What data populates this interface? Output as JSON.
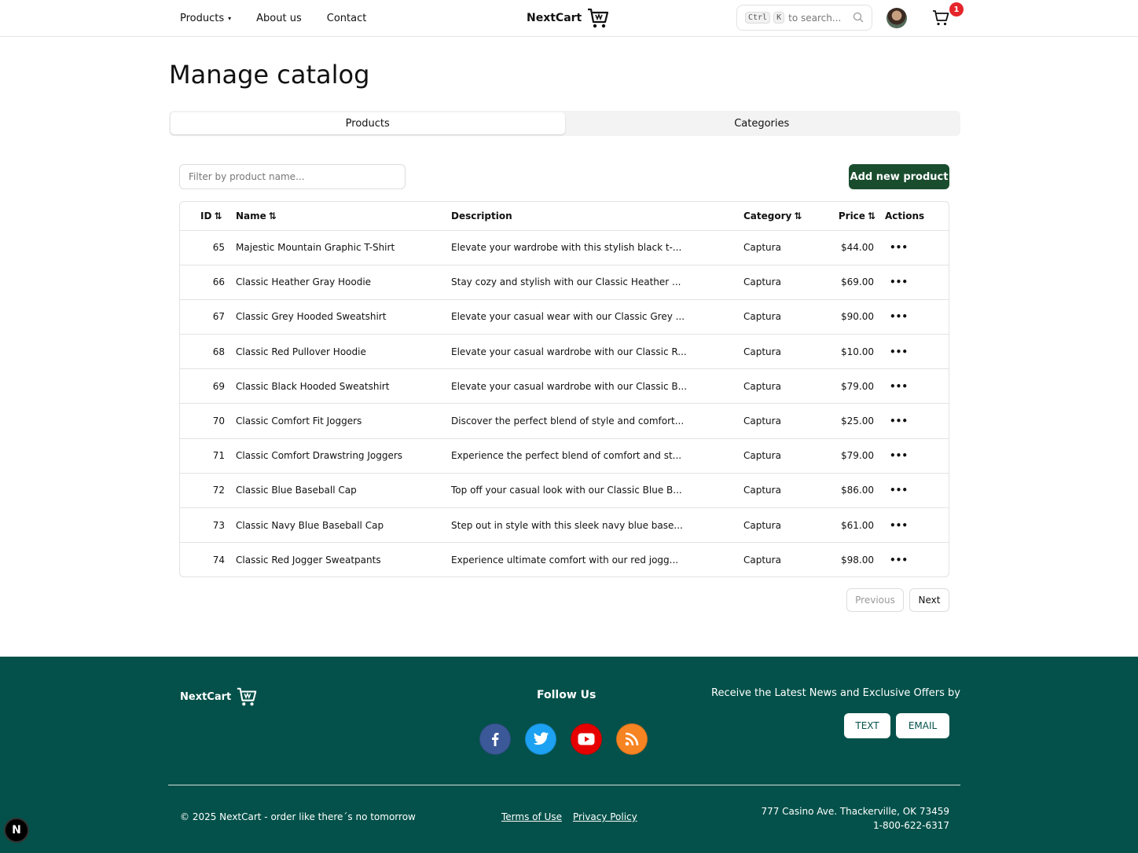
{
  "header": {
    "nav": [
      {
        "label": "Products",
        "has_dropdown": true
      },
      {
        "label": "About us"
      },
      {
        "label": "Contact"
      }
    ],
    "brand": "NextCart",
    "search": {
      "kbd1": "Ctrl",
      "kbd2": "K",
      "placeholder": "to search..."
    },
    "cart_count": "1"
  },
  "main": {
    "title": "Manage catalog",
    "tabs": [
      {
        "label": "Products",
        "active": true
      },
      {
        "label": "Categories",
        "active": false
      }
    ],
    "filter_placeholder": "Filter by product name...",
    "add_button": "Add new product",
    "columns": {
      "id": "ID",
      "name": "Name",
      "description": "Description",
      "category": "Category",
      "price": "Price",
      "actions": "Actions"
    },
    "sort_glyph": "⇅",
    "actions_glyph": "•••",
    "rows": [
      {
        "id": "65",
        "name": "Majestic Mountain Graphic T-Shirt",
        "description": "Elevate your wardrobe with this stylish black t-...",
        "category": "Captura",
        "price": "$44.00"
      },
      {
        "id": "66",
        "name": "Classic Heather Gray Hoodie",
        "description": "Stay cozy and stylish with our Classic Heather ...",
        "category": "Captura",
        "price": "$69.00"
      },
      {
        "id": "67",
        "name": "Classic Grey Hooded Sweatshirt",
        "description": "Elevate your casual wear with our Classic Grey ...",
        "category": "Captura",
        "price": "$90.00"
      },
      {
        "id": "68",
        "name": "Classic Red Pullover Hoodie",
        "description": "Elevate your casual wardrobe with our Classic R...",
        "category": "Captura",
        "price": "$10.00"
      },
      {
        "id": "69",
        "name": "Classic Black Hooded Sweatshirt",
        "description": "Elevate your casual wardrobe with our Classic B...",
        "category": "Captura",
        "price": "$79.00"
      },
      {
        "id": "70",
        "name": "Classic Comfort Fit Joggers",
        "description": "Discover the perfect blend of style and comfort...",
        "category": "Captura",
        "price": "$25.00"
      },
      {
        "id": "71",
        "name": "Classic Comfort Drawstring Joggers",
        "description": "Experience the perfect blend of comfort and st...",
        "category": "Captura",
        "price": "$79.00"
      },
      {
        "id": "72",
        "name": "Classic Blue Baseball Cap",
        "description": "Top off your casual look with our Classic Blue B...",
        "category": "Captura",
        "price": "$86.00"
      },
      {
        "id": "73",
        "name": "Classic Navy Blue Baseball Cap",
        "description": "Step out in style with this sleek navy blue base...",
        "category": "Captura",
        "price": "$61.00"
      },
      {
        "id": "74",
        "name": "Classic Red Jogger Sweatpants",
        "description": "Experience ultimate comfort with our red jogg...",
        "category": "Captura",
        "price": "$98.00"
      }
    ],
    "pagination": {
      "previous": "Previous",
      "next": "Next"
    }
  },
  "footer": {
    "brand": "NextCart",
    "follow_title": "Follow Us",
    "socials": [
      "facebook-icon",
      "twitter-icon",
      "youtube-icon",
      "rss-icon"
    ],
    "news_text": "Receive the Latest News and Exclusive Offers by",
    "text_button": "TEXT",
    "email_button": "EMAIL",
    "copyright": "© 2025 NextCart - order like there´s no tomorrow",
    "terms": "Terms of Use",
    "privacy": "Privacy Policy",
    "address": "777 Casino Ave. Thackerville, OK 73459",
    "phone": "1-800-622-6317"
  },
  "dev_badge": "N",
  "colors": {
    "primary": "#1a4d2e",
    "footer": "#03514a",
    "badge": "#e5252a"
  }
}
